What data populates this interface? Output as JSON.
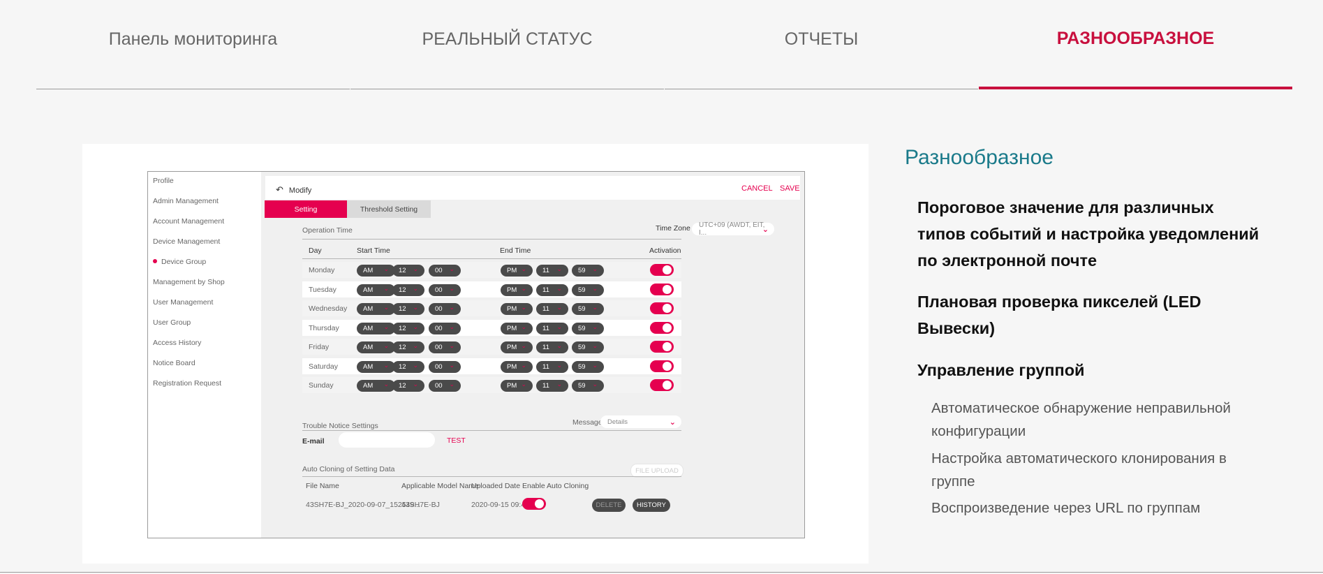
{
  "tabs": [
    {
      "label": "Панель мониторинга",
      "active": false
    },
    {
      "label": "РЕАЛЬНЫЙ СТАТУС",
      "active": false
    },
    {
      "label": "ОТЧЕТЫ",
      "active": false
    },
    {
      "label": "РАЗНООБРАЗНОЕ",
      "active": true
    }
  ],
  "colors": {
    "accent": "#c8103e",
    "teal": "#1a7a8a",
    "pink": "#e5004f",
    "dark": "#4a4a4a"
  },
  "app": {
    "sidebar": [
      {
        "label": "Profile"
      },
      {
        "label": "Admin Management"
      },
      {
        "label": "Account Management"
      },
      {
        "label": "Device Management"
      },
      {
        "label": "Device Group",
        "active": true
      },
      {
        "label": "Management by Shop"
      },
      {
        "label": "User Management"
      },
      {
        "label": "User Group"
      },
      {
        "label": "Access History"
      },
      {
        "label": "Notice Board"
      },
      {
        "label": "Registration Request"
      }
    ],
    "header": {
      "back_icon": "back-arrow-icon",
      "title": "Modify",
      "cancel": "CANCEL",
      "save": "SAVE"
    },
    "subtabs": [
      {
        "label": "Setting",
        "active": true
      },
      {
        "label": "Threshold Setting",
        "active": false
      }
    ],
    "operation_time": {
      "label": "Operation Time",
      "tz_label": "Time Zone",
      "tz_value": "UTC+09 (AWDT, EIT, I...",
      "headers": {
        "day": "Day",
        "start": "Start Time",
        "end": "End Time",
        "activation": "Activation"
      },
      "rows": [
        {
          "day": "Monday",
          "s_ampm": "AM",
          "s_h": "12",
          "s_m": "00",
          "e_ampm": "PM",
          "e_h": "11",
          "e_m": "59"
        },
        {
          "day": "Tuesday",
          "s_ampm": "AM",
          "s_h": "12",
          "s_m": "00",
          "e_ampm": "PM",
          "e_h": "11",
          "e_m": "59"
        },
        {
          "day": "Wednesday",
          "s_ampm": "AM",
          "s_h": "12",
          "s_m": "00",
          "e_ampm": "PM",
          "e_h": "11",
          "e_m": "59"
        },
        {
          "day": "Thursday",
          "s_ampm": "AM",
          "s_h": "12",
          "s_m": "00",
          "e_ampm": "PM",
          "e_h": "11",
          "e_m": "59"
        },
        {
          "day": "Friday",
          "s_ampm": "AM",
          "s_h": "12",
          "s_m": "00",
          "e_ampm": "PM",
          "e_h": "11",
          "e_m": "59"
        },
        {
          "day": "Saturday",
          "s_ampm": "AM",
          "s_h": "12",
          "s_m": "00",
          "e_ampm": "PM",
          "e_h": "11",
          "e_m": "59"
        },
        {
          "day": "Sunday",
          "s_ampm": "AM",
          "s_h": "12",
          "s_m": "00",
          "e_ampm": "PM",
          "e_h": "11",
          "e_m": "59"
        }
      ]
    },
    "trouble": {
      "label": "Trouble Notice Settings",
      "message_label": "Message",
      "message_value": "Details",
      "email_label": "E-mail",
      "email_value": "",
      "test": "TEST"
    },
    "cloning": {
      "label": "Auto Cloning of Setting Data",
      "upload": "FILE UPLOAD",
      "headers": {
        "file": "File Name",
        "model": "Applicable Model Name",
        "date": "Uploaded Date",
        "enable": "Enable Auto Cloning"
      },
      "row": {
        "file": "43SH7E-BJ_2020-09-07_152549...",
        "model": "43SH7E-BJ",
        "date": "2020-09-15 09:46",
        "delete": "DELETE",
        "history": "HISTORY"
      }
    }
  },
  "right": {
    "title": "Разнообразное",
    "headings": [
      "Пороговое значение для различных типов событий и настройка уведомлений по электронной почте",
      "Плановая проверка пикселей (LED Вывески)",
      "Управление группой"
    ],
    "items": [
      "Автоматическое обнаружение неправильной конфигурации",
      "Настройка автоматического клонирования в группе",
      "Воспроизведение через URL по группам"
    ]
  }
}
